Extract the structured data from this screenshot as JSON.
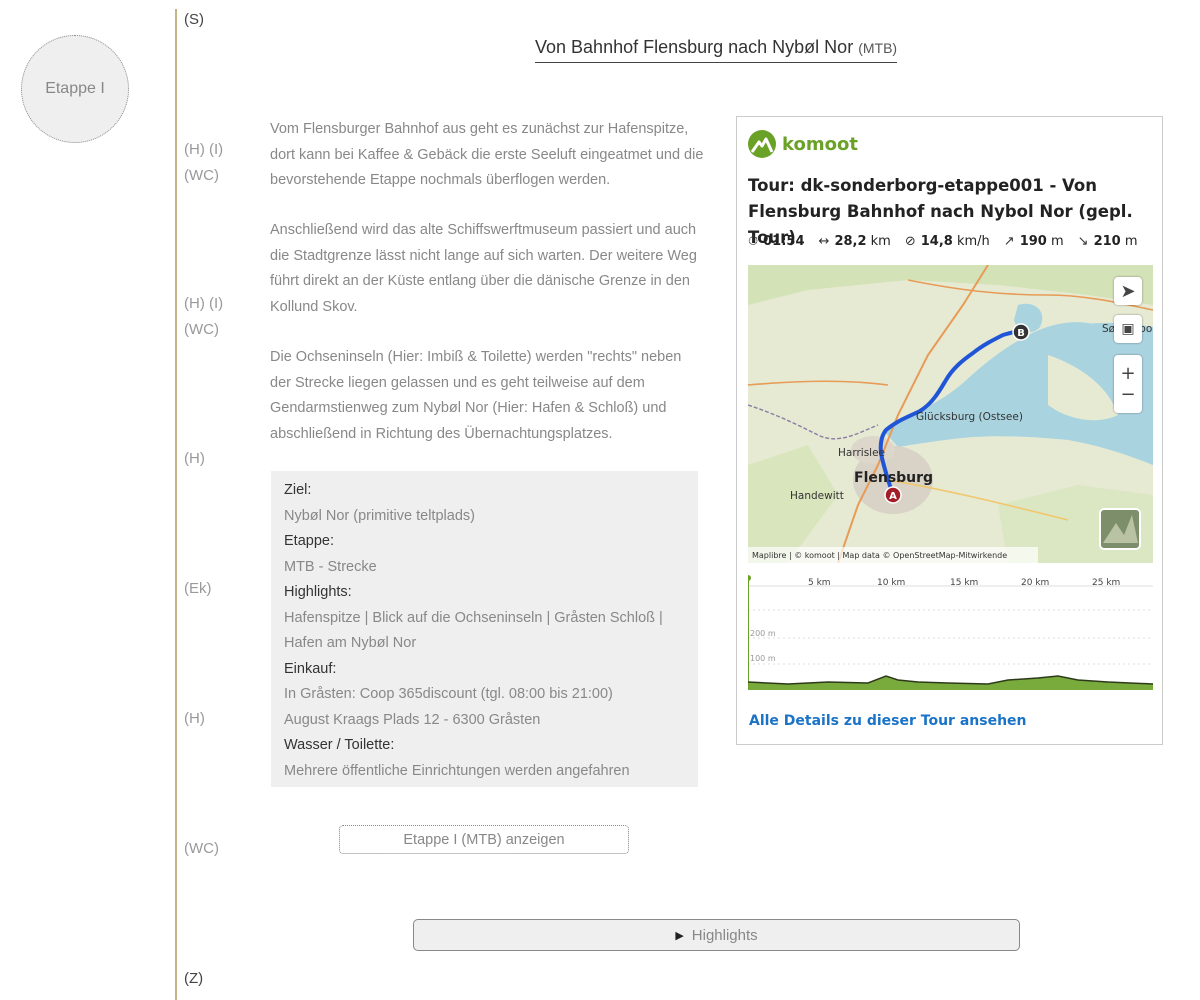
{
  "stage": {
    "label": "Etappe I"
  },
  "title": {
    "main": "Von Bahnhof Flensburg nach Nybøl Nor",
    "tag": "(MTB)"
  },
  "markers": {
    "start": "(S)",
    "m1a": "(H) (I)",
    "m1b": "(WC)",
    "m2a": "(H) (I)",
    "m2b": "(WC)",
    "m3": "(H)",
    "m4": "(Ek)",
    "m5": "(H)",
    "m6": "(WC)",
    "end": "(Z)"
  },
  "paragraphs": [
    "Vom Flensburger Bahnhof aus geht es zunächst zur Hafenspitze, dort kann bei Kaffee & Gebäck die erste Seeluft eingeatmet und die bevorstehende Etappe nochmals überflogen werden.",
    "Anschließend wird das alte Schiffswerftmuseum passiert und auch die Stadtgrenze lässt nicht lange auf sich warten. Der weitere Weg führt direkt an der Küste entlang über die dänische Grenze in den Kollund Skov.",
    "Die Ochseninseln (Hier: Imbiß & Toilette) werden \"rechts\" neben der Strecke liegen gelassen und es geht teilweise auf dem Gendarmstienweg zum Nybøl Nor (Hier: Hafen & Schloß) und abschließend in Richtung des Übernachtungsplatzes."
  ],
  "info": {
    "ziel_label": "Ziel:",
    "ziel_value": "Nybøl Nor (primitive teltplads)",
    "etappe_label": "Etappe:",
    "etappe_value": "MTB - Strecke",
    "highlights_label": "Highlights:",
    "highlights_value": "Hafenspitze | Blick auf die Ochseninseln | Gråsten Schloß | Hafen am Nybøl Nor",
    "einkauf_label": "Einkauf:",
    "einkauf_value1": "In Gråsten: Coop 365discount (tgl. 08:00 bis 21:00)",
    "einkauf_value2": "August Kraags Plads 12 - 6300 Gråsten",
    "wasser_label": "Wasser / Toilette:",
    "wasser_value": "Mehrere öffentliche Einrichtungen werden angefahren"
  },
  "buttons": {
    "etappe": "Etappe I (MTB) anzeigen",
    "highlights": "Highlights"
  },
  "komoot": {
    "brand": "komoot",
    "brand_color": "#6aa127",
    "tour_title": "Tour: dk-sonderborg-etappe001 - Von Flensburg Bahnhof nach Nybol Nor (gepl. Tour)",
    "duration": "01:54",
    "distance": "28,2",
    "distance_unit": "km",
    "speed": "14,8",
    "speed_unit": "km/h",
    "ascent": "190",
    "ascent_unit": "m",
    "descent": "210",
    "descent_unit": "m",
    "map": {
      "labels": {
        "gluecksburg": "Glücksburg (Ostsee)",
        "harrislee": "Harrislee",
        "flensburg": "Flensburg",
        "handewitt": "Handewitt",
        "sonderborg": "Sønderborg"
      },
      "start_marker": "A",
      "end_marker": "B",
      "attribution": "Maplibre | © komoot | Map data © OpenStreetMap-Mitwirkende",
      "zoom_in": "+",
      "zoom_out": "−"
    },
    "profile": {
      "km_labels": [
        "5 km",
        "10 km",
        "15 km",
        "20 km",
        "25 km"
      ],
      "alt_labels": [
        "200 m",
        "100 m"
      ]
    },
    "details_link": "Alle Details zu dieser Tour ansehen"
  }
}
